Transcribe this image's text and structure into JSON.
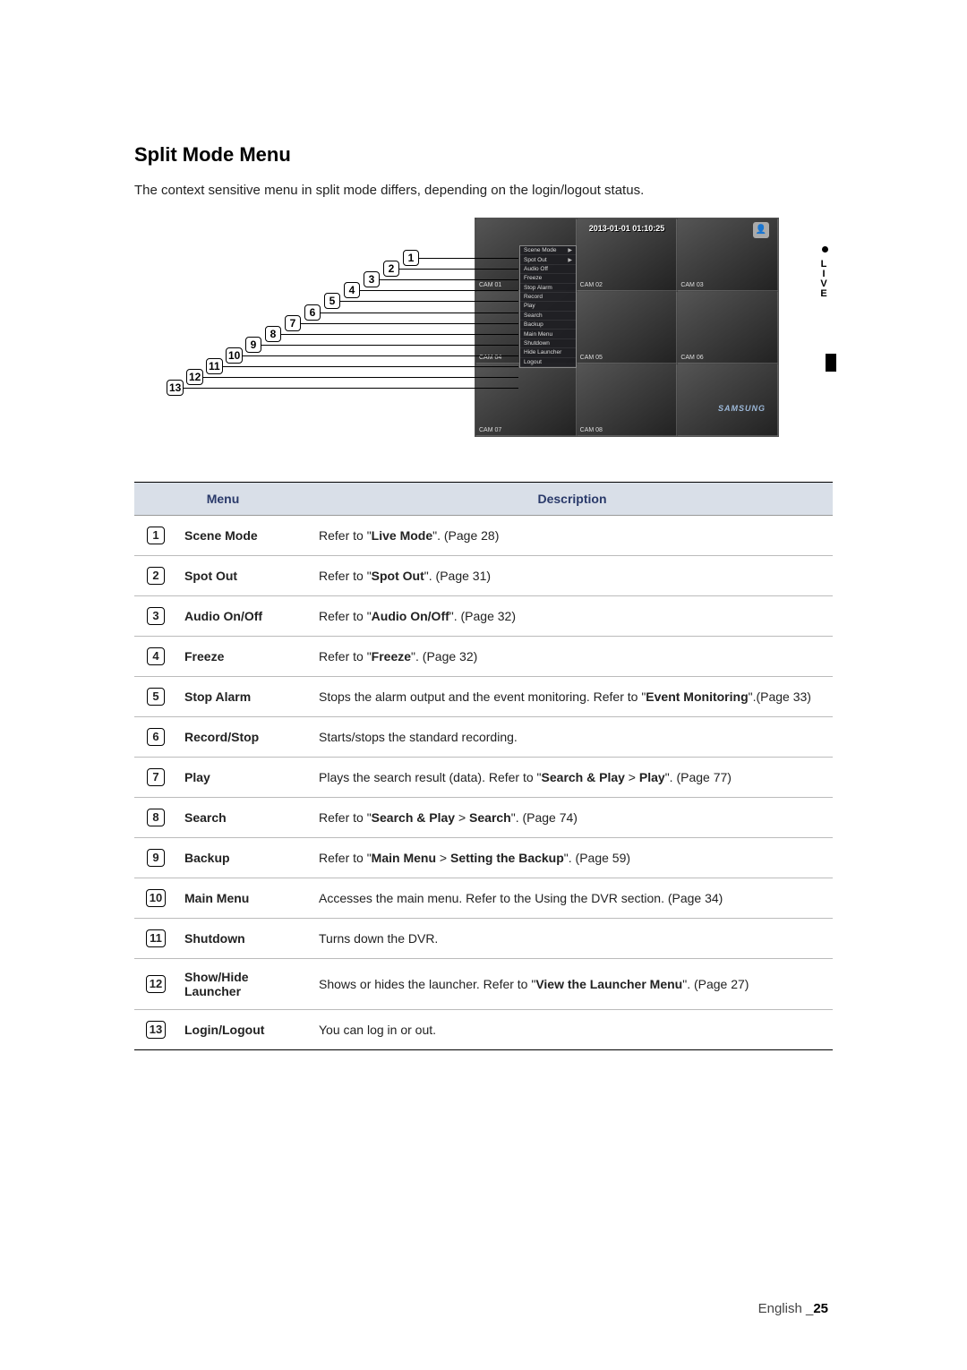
{
  "sideTab": {
    "label": "LIVE"
  },
  "section": {
    "title": "Split Mode Menu",
    "intro": "The context sensitive menu in split mode differs, depending on the login/logout status."
  },
  "figure": {
    "timestamp": "2013-01-01 01:10:25",
    "camLabels": [
      "CAM 01",
      "CAM 02",
      "CAM 03",
      "CAM 04",
      "CAM 05",
      "CAM 06",
      "CAM 07",
      "CAM 08"
    ],
    "brand": "SAMSUNG",
    "contextMenu": [
      {
        "label": "Scene Mode",
        "arrow": true
      },
      {
        "label": "Spot Out",
        "arrow": true
      },
      {
        "label": "Audio Off",
        "arrow": false
      },
      {
        "label": "Freeze",
        "arrow": false
      },
      {
        "label": "Stop Alarm",
        "arrow": false
      },
      {
        "label": "Record",
        "arrow": false
      },
      {
        "label": "Play",
        "arrow": false
      },
      {
        "label": "Search",
        "arrow": false
      },
      {
        "label": "Backup",
        "arrow": false
      },
      {
        "label": "Main Menu",
        "arrow": false
      },
      {
        "label": "Shutdown",
        "arrow": false
      },
      {
        "label": "Hide Launcher",
        "arrow": false
      },
      {
        "label": "Logout",
        "arrow": false
      }
    ]
  },
  "table": {
    "headers": {
      "menu": "Menu",
      "desc": "Description"
    },
    "rows": [
      {
        "num": "1",
        "menu": "Scene Mode",
        "desc": "Refer to \"<b>Live Mode</b>\". (Page 28)"
      },
      {
        "num": "2",
        "menu": "Spot Out",
        "desc": "Refer to \"<b>Spot Out</b>\". (Page 31)"
      },
      {
        "num": "3",
        "menu": "Audio On/Off",
        "desc": "Refer to \"<b>Audio On/Off</b>\". (Page 32)"
      },
      {
        "num": "4",
        "menu": "Freeze",
        "desc": "Refer to \"<b>Freeze</b>\". (Page 32)"
      },
      {
        "num": "5",
        "menu": "Stop Alarm",
        "desc": "Stops the alarm output and the event monitoring. Refer to \"<b>Event Monitoring</b>\".(Page 33)"
      },
      {
        "num": "6",
        "menu": "Record/Stop",
        "desc": "Starts/stops the standard recording."
      },
      {
        "num": "7",
        "menu": "Play",
        "desc": "Plays the search result (data). Refer to \"<b>Search & Play</b> > <b>Play</b>\". (Page 77)"
      },
      {
        "num": "8",
        "menu": "Search",
        "desc": "Refer to \"<b>Search & Play</b> > <b>Search</b>\". (Page 74)"
      },
      {
        "num": "9",
        "menu": "Backup",
        "desc": "Refer to \"<b>Main Menu</b> > <b>Setting the Backup</b>\". (Page 59)"
      },
      {
        "num": "10",
        "menu": "Main Menu",
        "desc": "Accesses the main menu. Refer to the Using the DVR section. (Page 34)"
      },
      {
        "num": "11",
        "menu": "Shutdown",
        "desc": "Turns down the DVR."
      },
      {
        "num": "12",
        "menu": "Show/Hide Launcher",
        "desc": "Shows or hides the launcher. Refer to \"<b>View the Launcher Menu</b>\". (Page 27)"
      },
      {
        "num": "13",
        "menu": "Login/Logout",
        "desc": "You can log in or out."
      }
    ]
  },
  "footer": {
    "lang": "English",
    "page": "25"
  }
}
